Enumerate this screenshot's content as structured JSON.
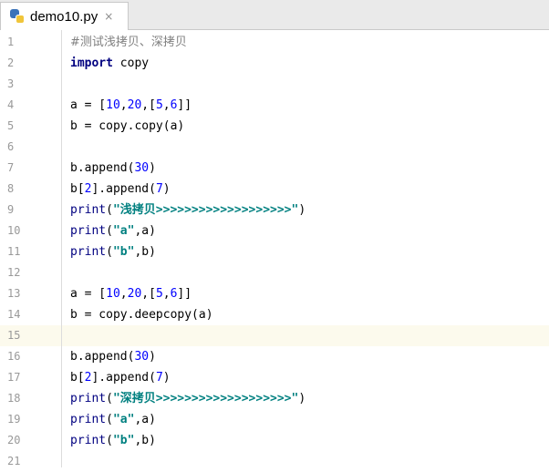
{
  "tab": {
    "filename": "demo10.py",
    "close_glyph": "×"
  },
  "editor": {
    "current_line": 15,
    "lines": [
      {
        "n": "1",
        "tokens": [
          {
            "t": "comment",
            "v": "#测试浅拷贝、深拷贝"
          }
        ]
      },
      {
        "n": "2",
        "tokens": [
          {
            "t": "kw",
            "v": "import"
          },
          {
            "t": "plain",
            "v": " copy"
          }
        ]
      },
      {
        "n": "3",
        "tokens": []
      },
      {
        "n": "4",
        "tokens": [
          {
            "t": "plain",
            "v": "a = ["
          },
          {
            "t": "num",
            "v": "10"
          },
          {
            "t": "plain",
            "v": ","
          },
          {
            "t": "num",
            "v": "20"
          },
          {
            "t": "plain",
            "v": ",["
          },
          {
            "t": "num",
            "v": "5"
          },
          {
            "t": "plain",
            "v": ","
          },
          {
            "t": "num",
            "v": "6"
          },
          {
            "t": "plain",
            "v": "]]"
          }
        ]
      },
      {
        "n": "5",
        "tokens": [
          {
            "t": "plain",
            "v": "b = copy.copy(a)"
          }
        ]
      },
      {
        "n": "6",
        "tokens": []
      },
      {
        "n": "7",
        "tokens": [
          {
            "t": "plain",
            "v": "b.append("
          },
          {
            "t": "num",
            "v": "30"
          },
          {
            "t": "plain",
            "v": ")"
          }
        ]
      },
      {
        "n": "8",
        "tokens": [
          {
            "t": "plain",
            "v": "b["
          },
          {
            "t": "num",
            "v": "2"
          },
          {
            "t": "plain",
            "v": "].append("
          },
          {
            "t": "num",
            "v": "7"
          },
          {
            "t": "plain",
            "v": ")"
          }
        ]
      },
      {
        "n": "9",
        "tokens": [
          {
            "t": "builtin",
            "v": "print"
          },
          {
            "t": "plain",
            "v": "("
          },
          {
            "t": "str",
            "v": "\"浅拷贝>>>>>>>>>>>>>>>>>>>\""
          },
          {
            "t": "plain",
            "v": ")"
          }
        ]
      },
      {
        "n": "10",
        "tokens": [
          {
            "t": "builtin",
            "v": "print"
          },
          {
            "t": "plain",
            "v": "("
          },
          {
            "t": "str",
            "v": "\"a\""
          },
          {
            "t": "plain",
            "v": ",a)"
          }
        ]
      },
      {
        "n": "11",
        "tokens": [
          {
            "t": "builtin",
            "v": "print"
          },
          {
            "t": "plain",
            "v": "("
          },
          {
            "t": "str",
            "v": "\"b\""
          },
          {
            "t": "plain",
            "v": ",b)"
          }
        ]
      },
      {
        "n": "12",
        "tokens": []
      },
      {
        "n": "13",
        "tokens": [
          {
            "t": "plain",
            "v": "a = ["
          },
          {
            "t": "num",
            "v": "10"
          },
          {
            "t": "plain",
            "v": ","
          },
          {
            "t": "num",
            "v": "20"
          },
          {
            "t": "plain",
            "v": ",["
          },
          {
            "t": "num",
            "v": "5"
          },
          {
            "t": "plain",
            "v": ","
          },
          {
            "t": "num",
            "v": "6"
          },
          {
            "t": "plain",
            "v": "]]"
          }
        ]
      },
      {
        "n": "14",
        "tokens": [
          {
            "t": "plain",
            "v": "b = copy.deepcopy(a)"
          }
        ]
      },
      {
        "n": "15",
        "tokens": []
      },
      {
        "n": "16",
        "tokens": [
          {
            "t": "plain",
            "v": "b.append("
          },
          {
            "t": "num",
            "v": "30"
          },
          {
            "t": "plain",
            "v": ")"
          }
        ]
      },
      {
        "n": "17",
        "tokens": [
          {
            "t": "plain",
            "v": "b["
          },
          {
            "t": "num",
            "v": "2"
          },
          {
            "t": "plain",
            "v": "].append("
          },
          {
            "t": "num",
            "v": "7"
          },
          {
            "t": "plain",
            "v": ")"
          }
        ]
      },
      {
        "n": "18",
        "tokens": [
          {
            "t": "builtin",
            "v": "print"
          },
          {
            "t": "plain",
            "v": "("
          },
          {
            "t": "str",
            "v": "\"深拷贝>>>>>>>>>>>>>>>>>>>\""
          },
          {
            "t": "plain",
            "v": ")"
          }
        ]
      },
      {
        "n": "19",
        "tokens": [
          {
            "t": "builtin",
            "v": "print"
          },
          {
            "t": "plain",
            "v": "("
          },
          {
            "t": "str",
            "v": "\"a\""
          },
          {
            "t": "plain",
            "v": ",a)"
          }
        ]
      },
      {
        "n": "20",
        "tokens": [
          {
            "t": "builtin",
            "v": "print"
          },
          {
            "t": "plain",
            "v": "("
          },
          {
            "t": "str",
            "v": "\"b\""
          },
          {
            "t": "plain",
            "v": ",b)"
          }
        ]
      },
      {
        "n": "21",
        "tokens": []
      }
    ]
  },
  "colors": {
    "keyword": "#000080",
    "number": "#0000ff",
    "string": "#008080",
    "comment": "#808080",
    "current_line": "#fcfaed"
  }
}
